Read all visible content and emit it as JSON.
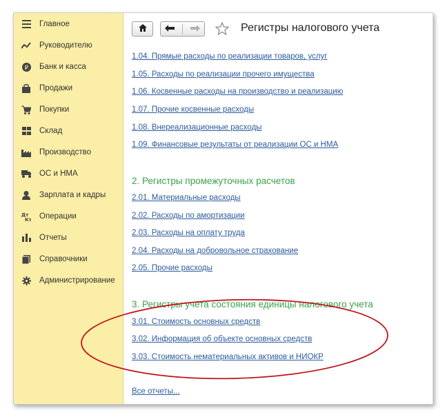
{
  "sidebar": {
    "items": [
      {
        "label": "Главное",
        "icon": "menu-icon"
      },
      {
        "label": "Руководителю",
        "icon": "trend-icon"
      },
      {
        "label": "Банк и касса",
        "icon": "ruble-icon"
      },
      {
        "label": "Продажи",
        "icon": "bag-icon"
      },
      {
        "label": "Покупки",
        "icon": "cart-icon"
      },
      {
        "label": "Склад",
        "icon": "warehouse-icon"
      },
      {
        "label": "Производство",
        "icon": "factory-icon"
      },
      {
        "label": "ОС и НМА",
        "icon": "truck-icon"
      },
      {
        "label": "Зарплата и кадры",
        "icon": "person-icon"
      },
      {
        "label": "Операции",
        "icon": "dtkt-icon"
      },
      {
        "label": "Отчеты",
        "icon": "bar-chart-icon"
      },
      {
        "label": "Справочники",
        "icon": "book-icon"
      },
      {
        "label": "Администрирование",
        "icon": "gear-icon"
      }
    ]
  },
  "header": {
    "title": "Регистры налогового учета"
  },
  "group1": {
    "links": [
      "1.04. Прямые расходы по реализации товаров, услуг",
      "1.05. Расходы по реализации прочего имущества",
      "1.06. Косвенные расходы на производство и реализацию",
      "1.07. Прочие косвенные расходы",
      "1.08. Внереализационные расходы",
      "1.09. Финансовые результаты от реализации ОС и НМА"
    ]
  },
  "group2": {
    "title": "2. Регистры промежуточных расчетов",
    "links": [
      "2.01. Материальные расходы",
      "2.02. Расходы по амортизации",
      "2.03. Расходы на оплату труда",
      "2.04. Расходы на добровольное страхование",
      "2.05. Прочие расходы"
    ]
  },
  "group3": {
    "title": "3. Регистры учета состояния единицы налогового учета",
    "links": [
      "3.01. Стоимость основных средств",
      "3.02. Информация об объекте основных средств",
      "3.03. Стоимость нематериальных активов и НИОКР"
    ]
  },
  "footer": {
    "all_reports": "Все отчеты..."
  },
  "colors": {
    "sidebar": "#fbeea6",
    "link": "#2b5a9c",
    "section": "#3aa14a",
    "annotation": "#c0141c"
  }
}
